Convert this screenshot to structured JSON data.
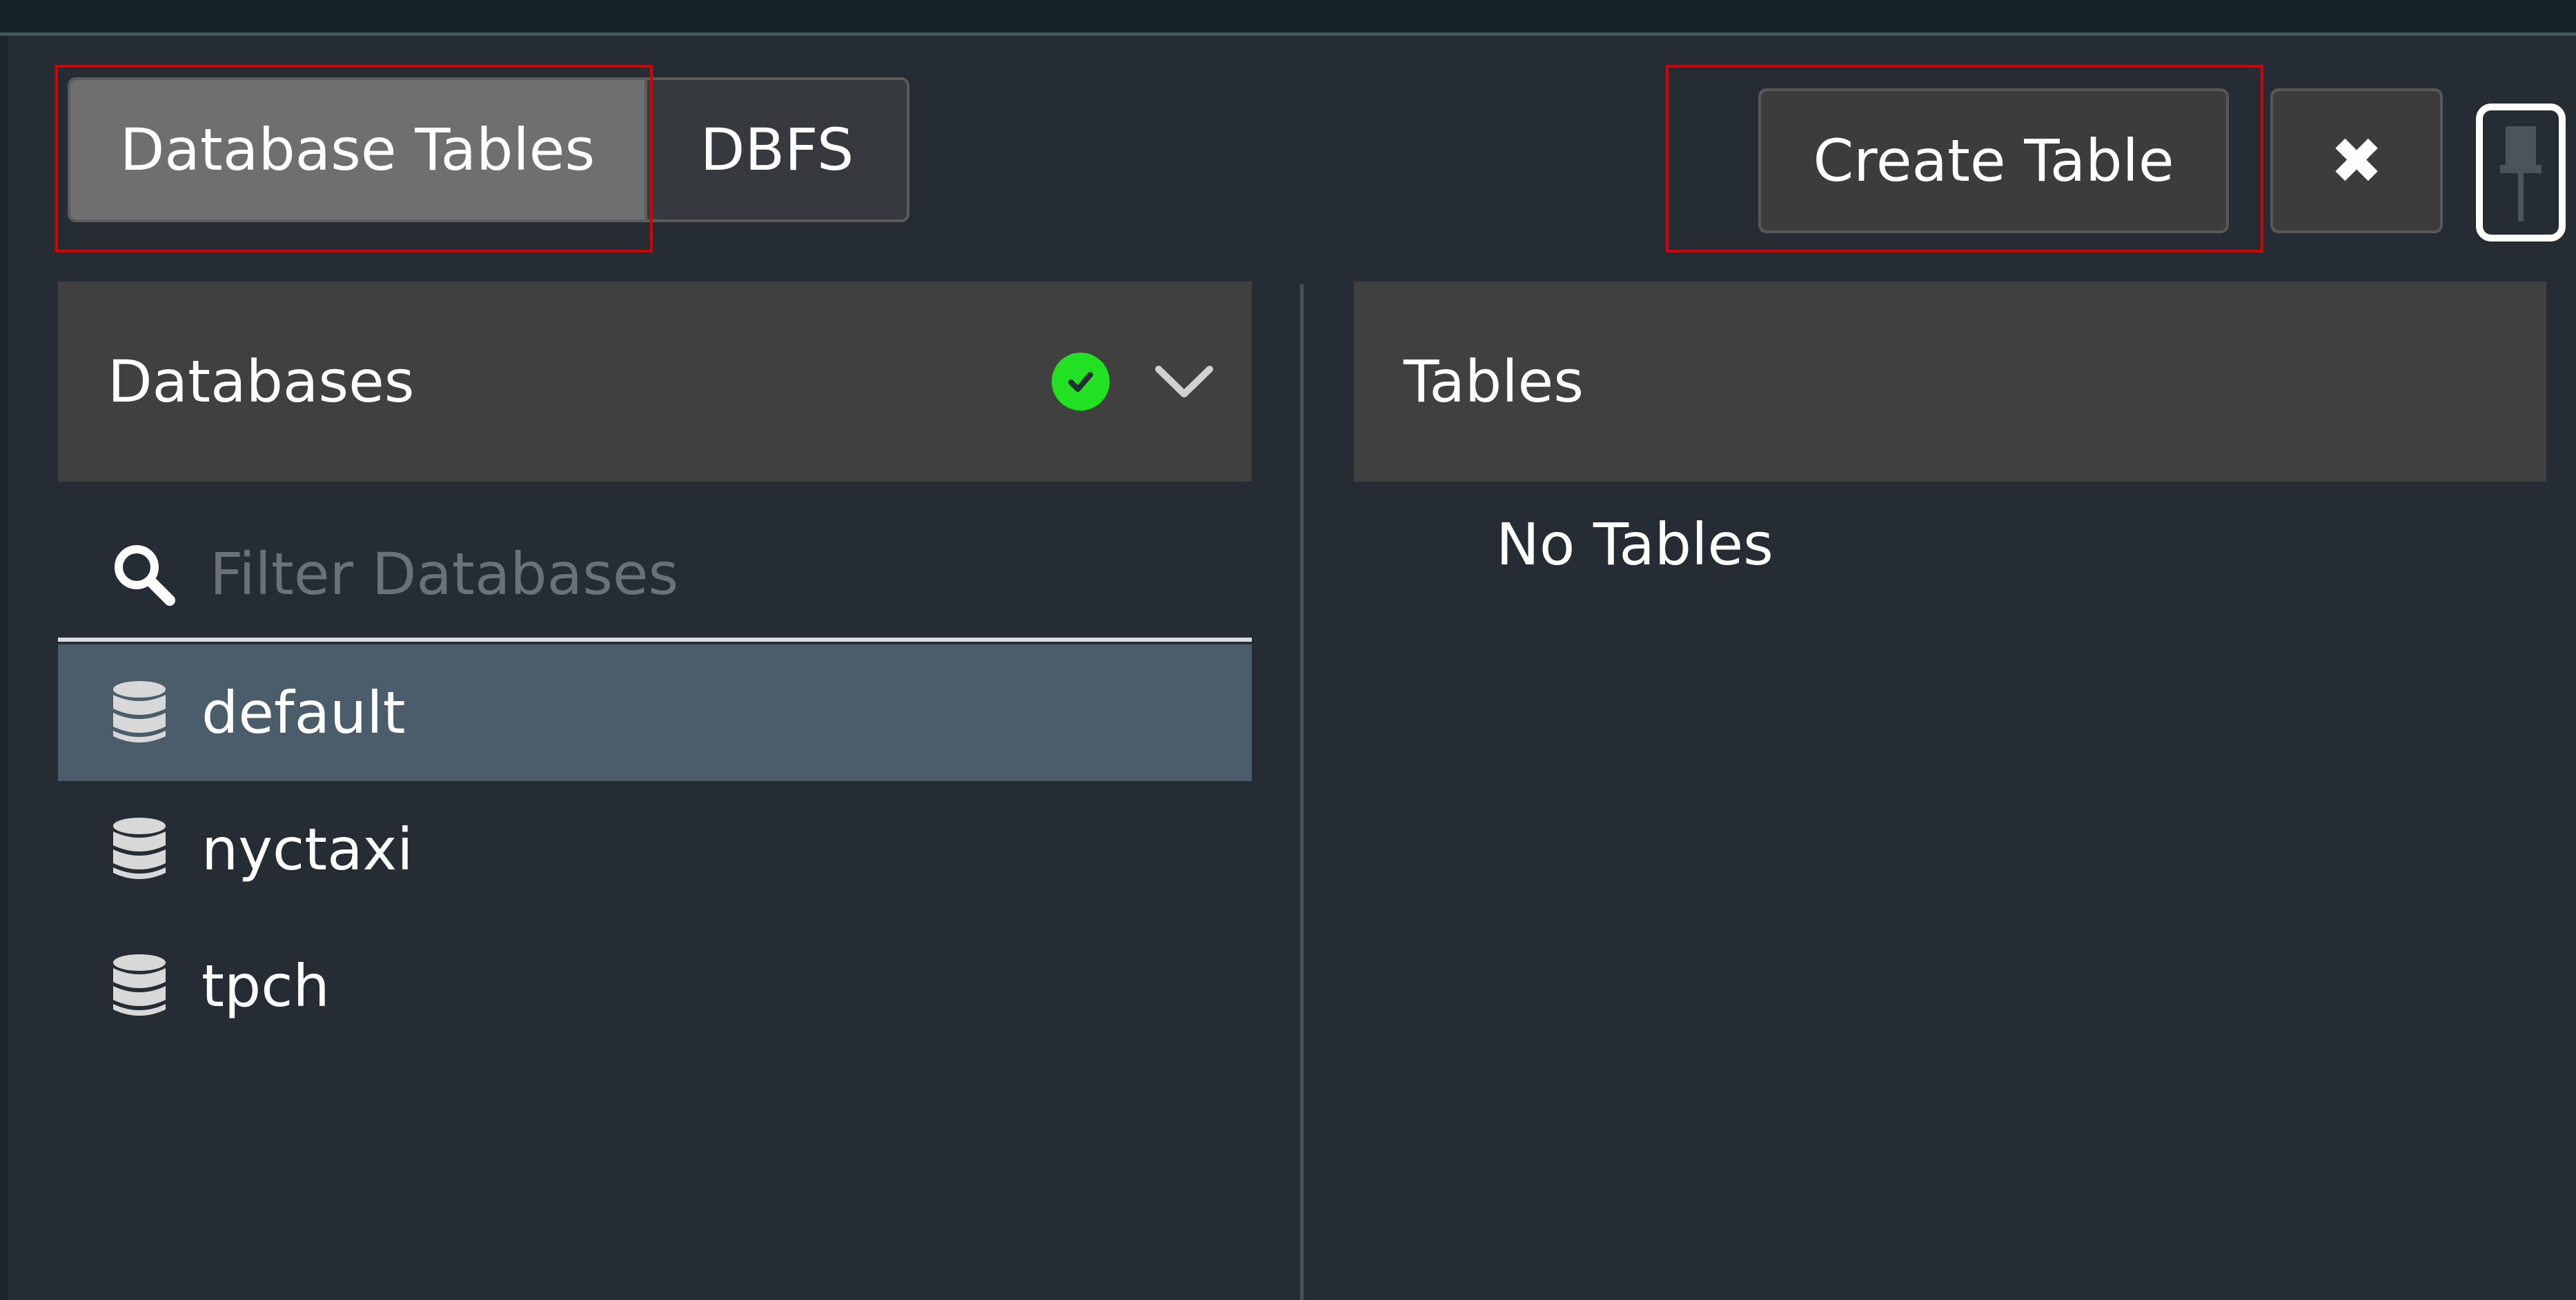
{
  "tabs": [
    {
      "label": "Database Tables",
      "active": true
    },
    {
      "label": "DBFS",
      "active": false
    }
  ],
  "toolbar": {
    "create_label": "Create Table",
    "close_icon": "close-icon",
    "pin_icon": "pin-icon"
  },
  "databases_panel": {
    "title": "Databases",
    "status_icon": "check-circle-icon",
    "status_color": "#22e022",
    "expand_icon": "chevron-down-icon",
    "filter_placeholder": "Filter Databases",
    "filter_value": "",
    "items": [
      {
        "label": "default",
        "icon": "database-icon",
        "selected": true
      },
      {
        "label": "nyctaxi",
        "icon": "database-icon",
        "selected": false
      },
      {
        "label": "tpch",
        "icon": "database-icon",
        "selected": false
      }
    ]
  },
  "tables_panel": {
    "title": "Tables",
    "empty_message": "No Tables"
  },
  "colors": {
    "background": "#262c34",
    "header": "#404040",
    "selected_row": "#4b5c6a",
    "annotation": "#d80000"
  }
}
